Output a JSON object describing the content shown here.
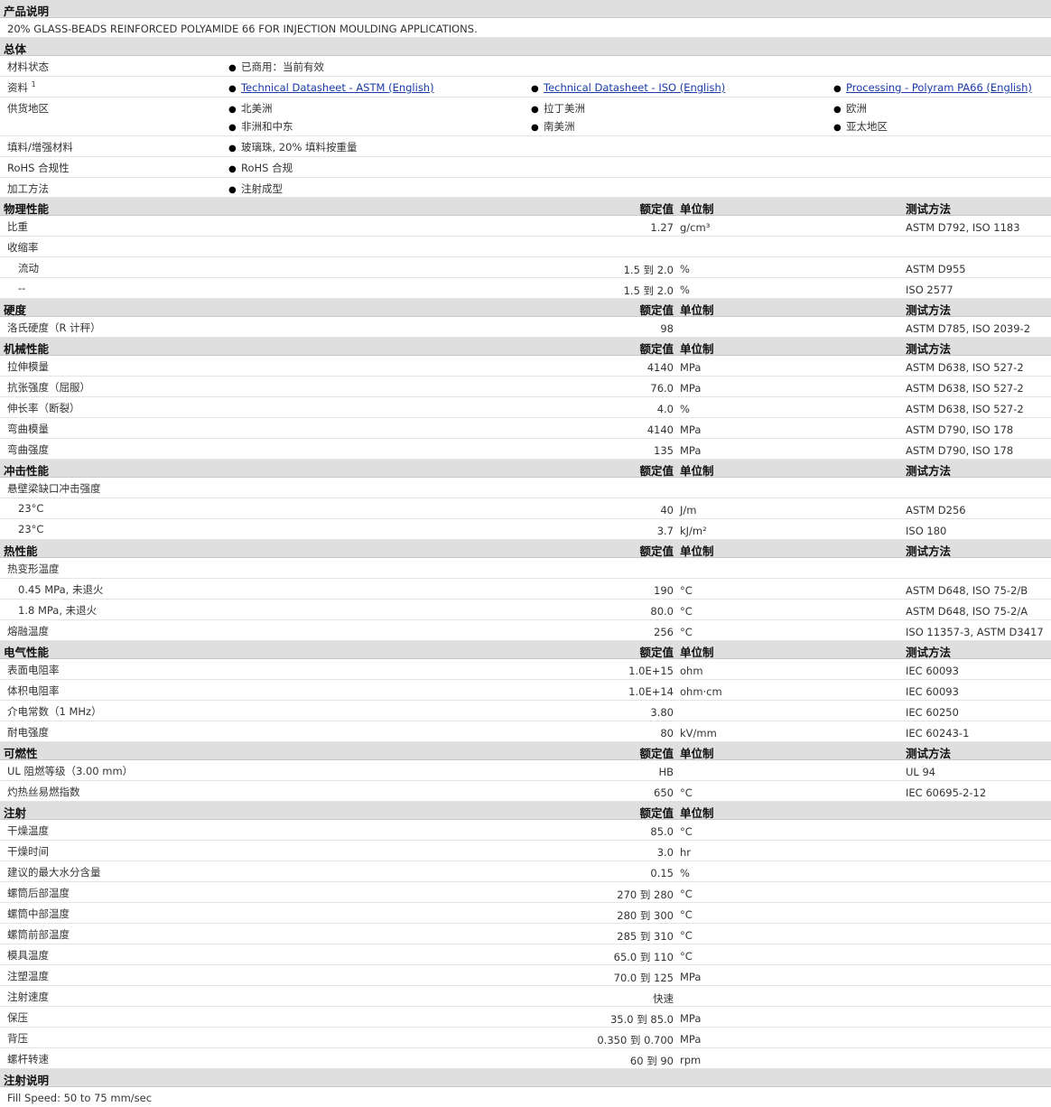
{
  "product_desc": {
    "title": "产品说明",
    "text": "20% GLASS-BEADS REINFORCED POLYAMIDE 66 FOR INJECTION MOULDING APPLICATIONS."
  },
  "general": {
    "title": "总体",
    "material_status_label": "材料状态",
    "material_status_value": "已商用：当前有效",
    "docs_label": "资料",
    "docs_sup": "1",
    "docs": [
      "Technical Datasheet - ASTM (English)",
      "Technical Datasheet - ISO (English)",
      "Processing - Polyram PA66 (English)"
    ],
    "availability_label": "供货地区",
    "availability": [
      "北美洲",
      "拉丁美洲",
      "欧洲",
      "非洲和中东",
      "南美洲",
      "亚太地区"
    ],
    "filler_label": "填料/增强材料",
    "filler_value": "玻璃珠, 20% 填料按重量",
    "rohs_label": "RoHS 合规性",
    "rohs_value": "RoHS 合规",
    "processing_label": "加工方法",
    "processing_value": "注射成型"
  },
  "headers": {
    "nominal": "额定值",
    "unit": "单位制",
    "method": "测试方法"
  },
  "physical": {
    "title": "物理性能",
    "rows": [
      {
        "label": "比重",
        "value": "1.27",
        "unit": "g/cm³",
        "method": "ASTM D792, ISO 1183"
      },
      {
        "label": "收缩率",
        "value": "",
        "unit": "",
        "method": ""
      },
      {
        "label": "流动",
        "value": "1.5 到  2.0",
        "unit": "%",
        "method": "ASTM D955"
      },
      {
        "label": "--",
        "value": "1.5 到  2.0",
        "unit": "%",
        "method": "ISO 2577"
      }
    ]
  },
  "hardness": {
    "title": "硬度",
    "rows": [
      {
        "label": "洛氏硬度（R 计秤）",
        "value": "98",
        "unit": "",
        "method": "ASTM D785, ISO 2039-2"
      }
    ]
  },
  "mechanical": {
    "title": "机械性能",
    "rows": [
      {
        "label": "拉伸模量",
        "value": "4140",
        "unit": "MPa",
        "method": "ASTM D638, ISO 527-2"
      },
      {
        "label": "抗张强度（屈服）",
        "value": "76.0",
        "unit": "MPa",
        "method": "ASTM D638, ISO 527-2"
      },
      {
        "label": "伸长率（断裂）",
        "value": "4.0",
        "unit": "%",
        "method": "ASTM D638, ISO 527-2"
      },
      {
        "label": "弯曲模量",
        "value": "4140",
        "unit": "MPa",
        "method": "ASTM D790, ISO 178"
      },
      {
        "label": "弯曲强度",
        "value": "135",
        "unit": "MPa",
        "method": "ASTM D790, ISO 178"
      }
    ]
  },
  "impact": {
    "title": "冲击性能",
    "rows": [
      {
        "label": "悬壁梁缺口冲击强度",
        "value": "",
        "unit": "",
        "method": ""
      },
      {
        "label": "23°C",
        "value": "40",
        "unit": "J/m",
        "method": "ASTM D256"
      },
      {
        "label": "23°C",
        "value": "3.7",
        "unit": "kJ/m²",
        "method": "ISO 180"
      }
    ]
  },
  "thermal": {
    "title": "热性能",
    "rows": [
      {
        "label": "热变形温度",
        "value": "",
        "unit": "",
        "method": ""
      },
      {
        "label": "0.45 MPa, 未退火",
        "value": "190",
        "unit": "°C",
        "method": "ASTM D648, ISO 75-2/B"
      },
      {
        "label": "1.8 MPa, 未退火",
        "value": "80.0",
        "unit": "°C",
        "method": "ASTM D648, ISO 75-2/A"
      },
      {
        "label": "熔融温度",
        "value": "256",
        "unit": "°C",
        "method": "ISO 11357-3, ASTM D3417"
      }
    ]
  },
  "electrical": {
    "title": "电气性能",
    "rows": [
      {
        "label": "表面电阻率",
        "value": "1.0E+15",
        "unit": "ohm",
        "method": "IEC 60093"
      },
      {
        "label": "体积电阻率",
        "value": "1.0E+14",
        "unit": "ohm·cm",
        "method": "IEC 60093"
      },
      {
        "label": "介电常数（1 MHz）",
        "value": "3.80",
        "unit": "",
        "method": "IEC 60250"
      },
      {
        "label": "耐电强度",
        "value": "80",
        "unit": "kV/mm",
        "method": "IEC 60243-1"
      }
    ]
  },
  "flammability": {
    "title": "可燃性",
    "rows": [
      {
        "label": "UL 阻燃等级（3.00 mm）",
        "value": "HB",
        "unit": "",
        "method": "UL 94"
      },
      {
        "label": "灼热丝易燃指数",
        "value": "650",
        "unit": "°C",
        "method": "IEC 60695-2-12"
      }
    ]
  },
  "injection": {
    "title": "注射",
    "rows": [
      {
        "label": "干燥温度",
        "value": "85.0",
        "unit": "°C"
      },
      {
        "label": "干燥时间",
        "value": "3.0",
        "unit": "hr"
      },
      {
        "label": "建议的最大水分含量",
        "value": "0.15",
        "unit": "%"
      },
      {
        "label": "螺筒后部温度",
        "value": "270 到  280",
        "unit": "°C"
      },
      {
        "label": "螺筒中部温度",
        "value": "280 到  300",
        "unit": "°C"
      },
      {
        "label": "螺筒前部温度",
        "value": "285 到  310",
        "unit": "°C"
      },
      {
        "label": "模具温度",
        "value": "65.0 到  110",
        "unit": "°C"
      },
      {
        "label": "注塑温度",
        "value": "70.0 到  125",
        "unit": "MPa"
      },
      {
        "label": "注射速度",
        "value": "快速",
        "unit": ""
      },
      {
        "label": "保压",
        "value": "35.0 到  85.0",
        "unit": "MPa"
      },
      {
        "label": "背压",
        "value": "0.350 到  0.700",
        "unit": "MPa"
      },
      {
        "label": "螺杆转速",
        "value": "60 到  90",
        "unit": "rpm"
      }
    ]
  },
  "injection_notes": {
    "title": "注射说明",
    "text": "Fill Speed: 50 to 75 mm/sec"
  }
}
